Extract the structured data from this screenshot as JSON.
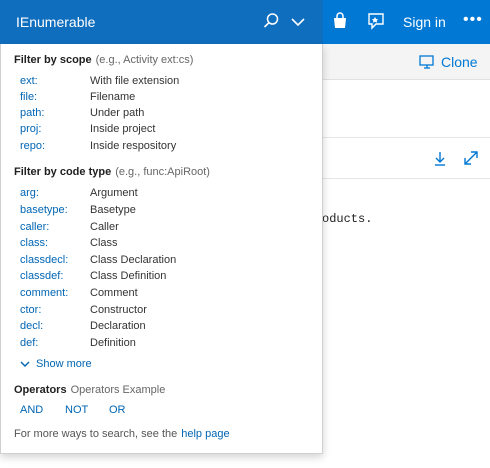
{
  "header": {
    "search_value": "IEnumerable",
    "signin_label": "Sign in",
    "more_label": "•••"
  },
  "toolbar": {
    "clone_label": "Clone"
  },
  "code": {
    "visible_text": "oducts."
  },
  "dropdown": {
    "scope_title": "Filter by scope",
    "scope_hint": "(e.g., Activity ext:cs)",
    "scope_rows": [
      {
        "key": "ext:",
        "desc": "With file extension"
      },
      {
        "key": "file:",
        "desc": "Filename"
      },
      {
        "key": "path:",
        "desc": "Under path"
      },
      {
        "key": "proj:",
        "desc": "Inside project"
      },
      {
        "key": "repo:",
        "desc": "Inside respository"
      }
    ],
    "code_title": "Filter by code type",
    "code_hint": "(e.g., func:ApiRoot)",
    "code_rows": [
      {
        "key": "arg:",
        "desc": "Argument"
      },
      {
        "key": "basetype:",
        "desc": "Basetype"
      },
      {
        "key": "caller:",
        "desc": "Caller"
      },
      {
        "key": "class:",
        "desc": "Class"
      },
      {
        "key": "classdecl:",
        "desc": "Class Declaration"
      },
      {
        "key": "classdef:",
        "desc": "Class Definition"
      },
      {
        "key": "comment:",
        "desc": "Comment"
      },
      {
        "key": "ctor:",
        "desc": "Constructor"
      },
      {
        "key": "decl:",
        "desc": "Declaration"
      },
      {
        "key": "def:",
        "desc": "Definition"
      }
    ],
    "show_more_label": "Show more",
    "operators_title": "Operators",
    "operators_hint": "Operators Example",
    "operators": [
      "AND",
      "NOT",
      "OR"
    ],
    "footer_text": "For more ways to search, see the",
    "footer_link": "help page"
  },
  "colors": {
    "brand": "#0078d4",
    "search_bg": "#106ebe",
    "link": "#0065b3"
  },
  "icons": [
    "search-icon",
    "chevron-down-icon",
    "bag-icon",
    "feedback-icon",
    "more-icon",
    "clone-icon",
    "download-icon",
    "expand-icon"
  ]
}
